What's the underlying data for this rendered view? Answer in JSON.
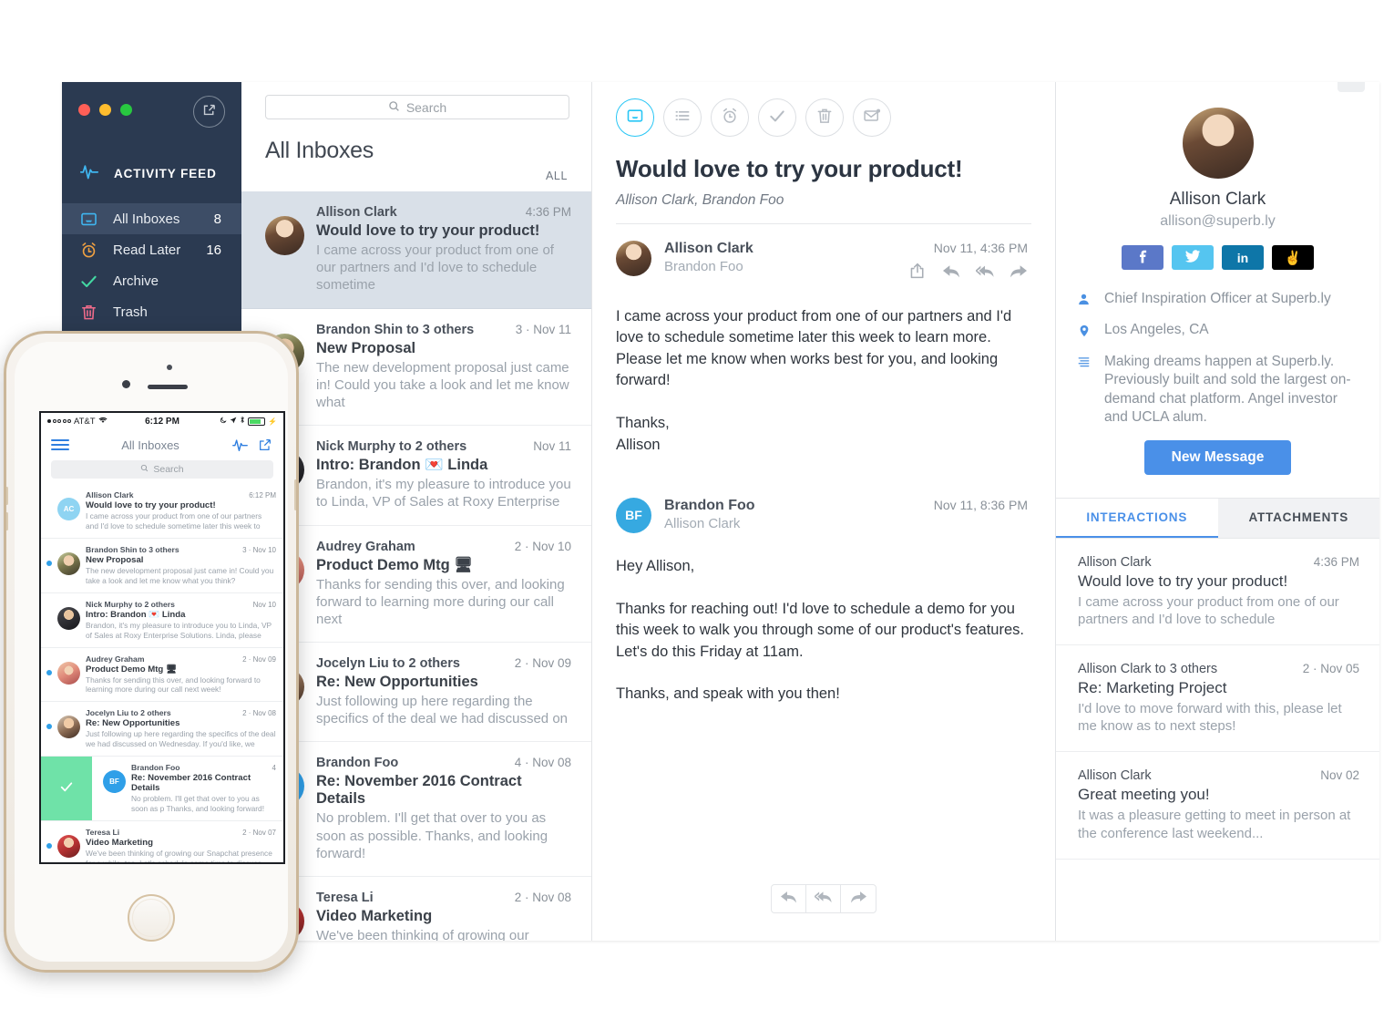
{
  "sidebar": {
    "compose_icon": "compose-icon",
    "activity_feed_label": "ACTIVITY FEED",
    "items": [
      {
        "label": "All Inboxes",
        "count": "8",
        "icon": "inbox-icon",
        "active": true
      },
      {
        "label": "Read Later",
        "count": "16",
        "icon": "alarm-icon",
        "active": false
      },
      {
        "label": "Archive",
        "count": "",
        "icon": "check-icon",
        "active": false
      },
      {
        "label": "Trash",
        "count": "",
        "icon": "trash-icon",
        "active": false
      }
    ]
  },
  "list": {
    "search_placeholder": "Search",
    "title": "All Inboxes",
    "filter_label": "ALL",
    "rows": [
      {
        "sender": "Allison Clark",
        "meta": "4:36 PM",
        "subject": "Would love to try your product!",
        "preview": "I came across your product from one of our partners and I'd love to schedule sometime",
        "selected": true,
        "avatar": "photo-allison"
      },
      {
        "sender": "Brandon Shin to 3 others",
        "meta": "3  ·  Nov 11",
        "subject": "New Proposal",
        "preview": "The new development proposal just came in! Could you take a look and let me know what",
        "selected": false,
        "avatar": "photo-brandonshin"
      },
      {
        "sender": "Nick Murphy to 2 others",
        "meta": "Nov 11",
        "subject": "Intro: Brandon 💌 Linda",
        "preview": "Brandon, it's my pleasure to introduce you to Linda, VP of Sales at Roxy Enterprise",
        "selected": false,
        "avatar": "photo-nick"
      },
      {
        "sender": "Audrey Graham",
        "meta": "2  ·  Nov 10",
        "subject": "Product Demo Mtg 🖥",
        "preview": "Thanks for sending this over, and looking forward to learning more during our call next",
        "selected": false,
        "avatar": "photo-audrey"
      },
      {
        "sender": "Jocelyn Liu to 2 others",
        "meta": "2  ·  Nov 09",
        "subject": "Re: New Opportunities",
        "preview": "Just following up here regarding the specifics of the deal we had discussed on",
        "selected": false,
        "avatar": "photo-jocelyn"
      },
      {
        "sender": "Brandon Foo",
        "meta": "4  ·  Nov 08",
        "subject": "Re: November 2016 Contract Details",
        "preview": "No problem. I'll get that over to you as soon as possible. Thanks, and looking forward!",
        "selected": false,
        "avatar": "photo-brandonfoo"
      },
      {
        "sender": "Teresa Li",
        "meta": "2  ·  Nov 08",
        "subject": "Video Marketing",
        "preview": "We've been thinking of growing our",
        "selected": false,
        "avatar": "photo-teresa"
      }
    ]
  },
  "thread": {
    "toolbar": [
      {
        "name": "inbox-icon",
        "active": true
      },
      {
        "name": "list-icon",
        "active": false
      },
      {
        "name": "alarm-icon",
        "active": false
      },
      {
        "name": "check-icon",
        "active": false
      },
      {
        "name": "trash-icon",
        "active": false
      },
      {
        "name": "mail-unread-icon",
        "active": false
      }
    ],
    "title": "Would love to try your product!",
    "participants": "Allison Clark, Brandon Foo",
    "messages": [
      {
        "from": "Allison Clark",
        "to": "Brandon Foo",
        "date": "Nov 11, 4:36 PM",
        "avatar_type": "photo",
        "initials": "",
        "body": "I came across your product from one of our partners and I'd love to schedule sometime later this week to learn more. Please let me know when works best for you, and looking forward!\n\nThanks,\nAllison",
        "actions": [
          "share-icon",
          "reply-icon",
          "reply-all-icon",
          "forward-icon"
        ]
      },
      {
        "from": "Brandon Foo",
        "to": "Allison Clark",
        "date": "Nov 11, 8:36 PM",
        "avatar_type": "initials",
        "initials": "BF",
        "body": "Hey Allison,\n\nThanks for reaching out! I'd love to schedule a demo for you this week to walk you through some of our product's features. Let's do this Friday at 11am.\n\nThanks, and speak with you then!",
        "actions": []
      }
    ],
    "bottom_actions": [
      "reply-icon",
      "reply-all-icon",
      "forward-icon"
    ]
  },
  "contact": {
    "expand_icon": "chevron-right-icon",
    "name": "Allison Clark",
    "email": "allison@superb.ly",
    "socials": [
      {
        "name": "facebook-icon",
        "glyph": "f",
        "color": "#5b78c8"
      },
      {
        "name": "twitter-icon",
        "glyph": "",
        "color": "#55c5f0"
      },
      {
        "name": "linkedin-icon",
        "glyph": "in",
        "color": "#0e76a8"
      },
      {
        "name": "angellist-icon",
        "glyph": "✌",
        "color": "#000000"
      }
    ],
    "details": [
      {
        "icon": "person-icon",
        "text": "Chief Inspiration Officer at Superb.ly"
      },
      {
        "icon": "location-icon",
        "text": "Los Angeles, CA"
      },
      {
        "icon": "bio-icon",
        "text": "Making dreams happen at Superb.ly. Previously built and sold the largest on-demand chat platform. Angel investor and UCLA alum."
      }
    ],
    "new_message_label": "New Message",
    "tabs": [
      {
        "label": "INTERACTIONS",
        "active": true
      },
      {
        "label": "ATTACHMENTS",
        "active": false
      }
    ],
    "interactions": [
      {
        "sender": "Allison Clark",
        "meta": "4:36 PM",
        "subject": "Would love to try your product!",
        "preview": "I came across your product from one of our partners and I'd love to schedule"
      },
      {
        "sender": "Allison Clark to 3 others",
        "meta": "2  ·  Nov 05",
        "subject": "Re: Marketing Project",
        "preview": "I'd love to move forward with this, please let me know as to next steps!"
      },
      {
        "sender": "Allison Clark",
        "meta": "Nov 02",
        "subject": "Great meeting you!",
        "preview": "It was a pleasure getting to meet in person at the conference last weekend..."
      }
    ]
  },
  "phone": {
    "status": {
      "carrier": "AT&T",
      "time": "6:12 PM"
    },
    "nav": {
      "title": "All Inboxes",
      "menu_icon": "hamburger-icon",
      "activity_icon": "activity-icon",
      "compose_icon": "compose-icon"
    },
    "search_placeholder": "Search",
    "rows": [
      {
        "sender": "Allison Clark",
        "meta": "6:12 PM",
        "subject": "Would love to try your product!",
        "preview": "I came across your product from one of our partners and I'd love to schedule sometime later this week to",
        "unread": false,
        "avatar_type": "initials",
        "initials": "AC",
        "avatar": "",
        "swiped": false
      },
      {
        "sender": "Brandon Shin to 3 others",
        "meta": "3 · Nov 10",
        "subject": "New Proposal",
        "preview": "The new development proposal just came in! Could you take a look and let me know what you think?",
        "unread": true,
        "avatar_type": "photo",
        "initials": "",
        "avatar": "photo-brandonshin",
        "swiped": false
      },
      {
        "sender": "Nick Murphy to 2 others",
        "meta": "Nov 10",
        "subject": "Intro: Brandon 💌 Linda",
        "preview": "Brandon, it's my pleasure to introduce you to Linda, VP of Sales at Roxy Enterprise Solutions. Linda, please",
        "unread": false,
        "avatar_type": "photo",
        "initials": "",
        "avatar": "photo-nick",
        "swiped": false
      },
      {
        "sender": "Audrey Graham",
        "meta": "2 · Nov 09",
        "subject": "Product Demo Mtg 🖥",
        "preview": "Thanks for sending this over, and looking forward to learning more during our call next week!",
        "unread": true,
        "avatar_type": "photo",
        "initials": "",
        "avatar": "photo-audrey",
        "swiped": false
      },
      {
        "sender": "Jocelyn Liu to 2 others",
        "meta": "2 · Nov 08",
        "subject": "Re: New Opportunities",
        "preview": "Just following up here regarding the specifics of the deal we had discussed on Wednesday. If you'd like, we",
        "unread": true,
        "avatar_type": "photo",
        "initials": "",
        "avatar": "photo-jocelyn",
        "swiped": false
      },
      {
        "sender": "Brandon Foo",
        "meta": "4",
        "subject": "Re: November 2016 Contract Details",
        "preview": "No problem. I'll get that over to you as soon as p Thanks, and looking forward!",
        "unread": false,
        "avatar_type": "initials",
        "initials": "BF",
        "avatar": "",
        "swiped": true
      },
      {
        "sender": "Teresa Li",
        "meta": "2 · Nov 07",
        "subject": "Video Marketing",
        "preview": "We've been thinking of growing our Snapchat presence for a while, too. Let's schedule some time to discuss",
        "unread": true,
        "avatar_type": "photo",
        "initials": "",
        "avatar": "photo-teresa",
        "swiped": false
      }
    ]
  }
}
